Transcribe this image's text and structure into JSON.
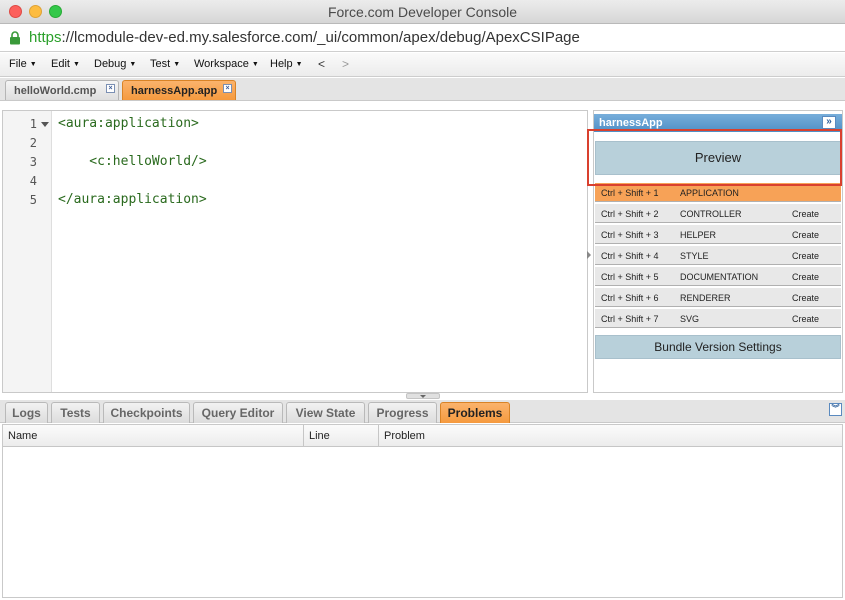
{
  "window": {
    "title": "Force.com Developer Console"
  },
  "url": {
    "scheme": "https",
    "rest": "://lcmodule-dev-ed.my.salesforce.com/_ui/common/apex/debug/ApexCSIPage"
  },
  "menu": {
    "items": [
      "File",
      "Edit",
      "Debug",
      "Test",
      "Workspace",
      "Help"
    ],
    "back": "<",
    "forward": ">"
  },
  "file_tabs": [
    {
      "label": "helloWorld.cmp",
      "active": false
    },
    {
      "label": "harnessApp.app",
      "active": true
    }
  ],
  "editor": {
    "lines": [
      {
        "no": "1",
        "code": "<aura:application>",
        "fold": true
      },
      {
        "no": "2",
        "code": "",
        "fold": false
      },
      {
        "no": "3",
        "code": "    <c:helloWorld/>",
        "fold": false
      },
      {
        "no": "4",
        "code": "",
        "fold": false
      },
      {
        "no": "5",
        "code": "</aura:application>",
        "fold": false
      }
    ]
  },
  "bundle": {
    "title": "harnessApp",
    "collapse_glyph": "»",
    "preview_label": "Preview",
    "rows": [
      {
        "shortcut_mod": "Ctrl + Shift + 1",
        "type": "APPLICATION",
        "action": "",
        "active": true
      },
      {
        "shortcut_mod": "Ctrl + Shift + 2",
        "type": "CONTROLLER",
        "action": "Create",
        "active": false
      },
      {
        "shortcut_mod": "Ctrl + Shift + 3",
        "type": "HELPER",
        "action": "Create",
        "active": false
      },
      {
        "shortcut_mod": "Ctrl + Shift + 4",
        "type": "STYLE",
        "action": "Create",
        "active": false
      },
      {
        "shortcut_mod": "Ctrl + Shift + 5",
        "type": "DOCUMENTATION",
        "action": "Create",
        "active": false
      },
      {
        "shortcut_mod": "Ctrl + Shift + 6",
        "type": "RENDERER",
        "action": "Create",
        "active": false
      },
      {
        "shortcut_mod": "Ctrl + Shift + 7",
        "type": "SVG",
        "action": "Create",
        "active": false
      }
    ],
    "version_settings_label": "Bundle Version Settings"
  },
  "bottom_tabs": [
    {
      "label": "Logs",
      "active": false
    },
    {
      "label": "Tests",
      "active": false
    },
    {
      "label": "Checkpoints",
      "active": false
    },
    {
      "label": "Query Editor",
      "active": false
    },
    {
      "label": "View State",
      "active": false
    },
    {
      "label": "Progress",
      "active": false
    },
    {
      "label": "Problems",
      "active": true
    }
  ],
  "problems_table": {
    "columns": [
      "Name",
      "Line",
      "Problem"
    ]
  },
  "colors": {
    "active_tab": "#f59a3e",
    "panel_header": "#4f8fc6",
    "highlight": "#d9402e",
    "code": "#2a6a1e",
    "url_scheme": "#2aa02a"
  }
}
